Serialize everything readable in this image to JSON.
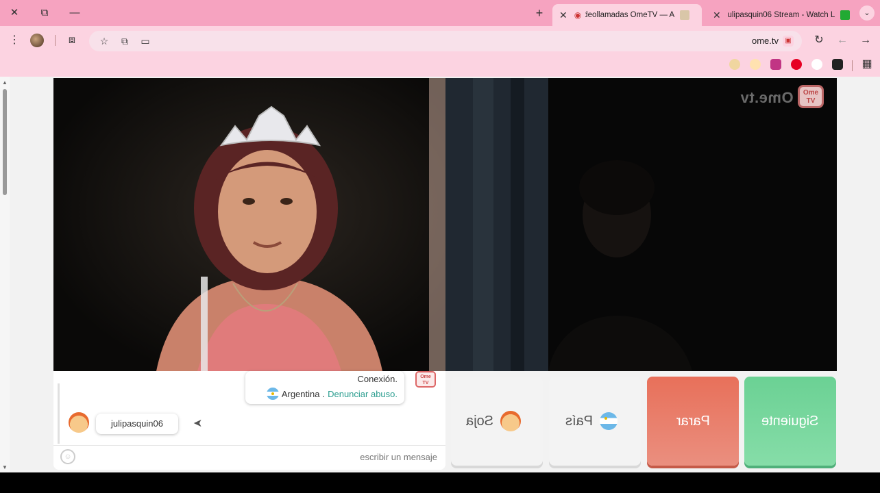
{
  "browser": {
    "tabs": [
      {
        "title": "julipasquin06 Stream - Watch L",
        "favicon_color": "#22aa33"
      },
      {
        "title": "Videollamadas OmeTV — A",
        "favicon_color": "#d9c6a8",
        "active": true
      }
    ],
    "new_tab_icon": "plus-icon",
    "tab_menu_icon": "chevron-down-icon",
    "url": "ome.tv",
    "bookmark_colors": [
      "#f0d6a0",
      "#ffe2b0",
      "#c13584",
      "#e60023",
      "#ffffff",
      "#222222"
    ]
  },
  "chat": {
    "system_message": {
      "line1": "Conexión.",
      "country": "Argentina",
      "separator": ".",
      "report_link": "Denunciar abuso."
    },
    "user_message": {
      "text": "julipasquin06"
    },
    "input_placeholder": "escribir un mensaje",
    "logo_text": "Ome TV"
  },
  "brand": {
    "name": "Ome.tv",
    "badge": "Ome TV"
  },
  "controls": {
    "soja": "Soja",
    "pais": "País",
    "parar": "Parar",
    "siguiente": "Siguiente"
  },
  "colors": {
    "tabbar": "#f6a3c0",
    "toolbar": "#fcd3e1",
    "stop": "#e8705a",
    "next": "#6bd194",
    "link": "#2a9d8f"
  }
}
